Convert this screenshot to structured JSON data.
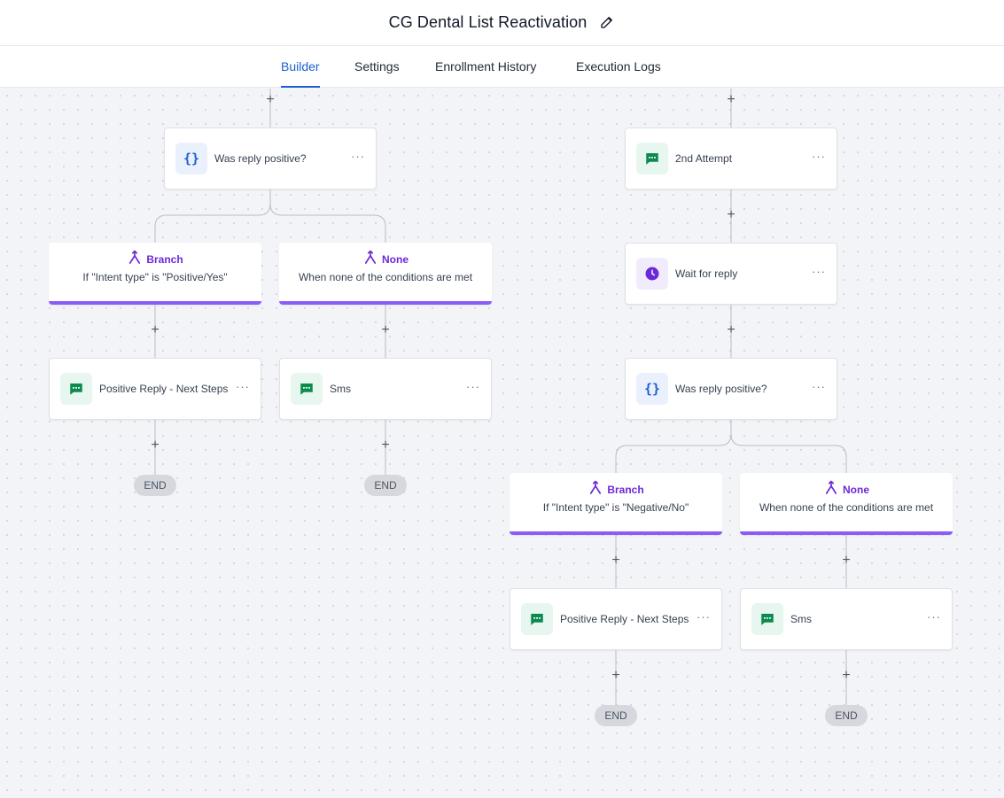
{
  "header": {
    "title": "CG Dental List Reactivation",
    "edit_icon": "pencil-icon"
  },
  "tabs": [
    {
      "label": "Builder",
      "active": true
    },
    {
      "label": "Settings",
      "active": false
    },
    {
      "label": "Enrollment History",
      "active": false
    },
    {
      "label": "Execution Logs",
      "active": false
    }
  ],
  "colors": {
    "accent": "#1d5fd1",
    "branch": "#8b5cf6",
    "sms_icon": "#0b8a4e",
    "wait_icon": "#6d28d9"
  },
  "workflow": {
    "plus_symbol": "+",
    "menu_symbol": "···",
    "left": {
      "condition": {
        "label": "Was reply positive?",
        "icon": "code-braces-icon"
      },
      "branches": [
        {
          "title": "Branch",
          "desc": "If \"Intent type\" is \"Positive/Yes\"",
          "icon": "branch-fork-icon"
        },
        {
          "title": "None",
          "desc": "When none of the conditions are met",
          "icon": "branch-fork-icon"
        }
      ],
      "actions": [
        {
          "label": "Positive Reply - Next Steps",
          "icon": "sms-message-icon"
        },
        {
          "label": "Sms",
          "icon": "sms-message-icon"
        }
      ],
      "end_labels": [
        "END",
        "END"
      ]
    },
    "right": {
      "steps": [
        {
          "label": "2nd Attempt",
          "icon": "sms-message-icon"
        },
        {
          "label": "Wait for reply",
          "icon": "clock-icon"
        },
        {
          "label": "Was reply positive?",
          "icon": "code-braces-icon"
        }
      ],
      "branches": [
        {
          "title": "Branch",
          "desc": "If \"Intent type\" is \"Negative/No\"",
          "icon": "branch-fork-icon"
        },
        {
          "title": "None",
          "desc": "When none of the conditions are met",
          "icon": "branch-fork-icon"
        }
      ],
      "actions": [
        {
          "label": "Positive Reply - Next Steps",
          "icon": "sms-message-icon"
        },
        {
          "label": "Sms",
          "icon": "sms-message-icon"
        }
      ],
      "end_labels": [
        "END",
        "END"
      ]
    }
  }
}
